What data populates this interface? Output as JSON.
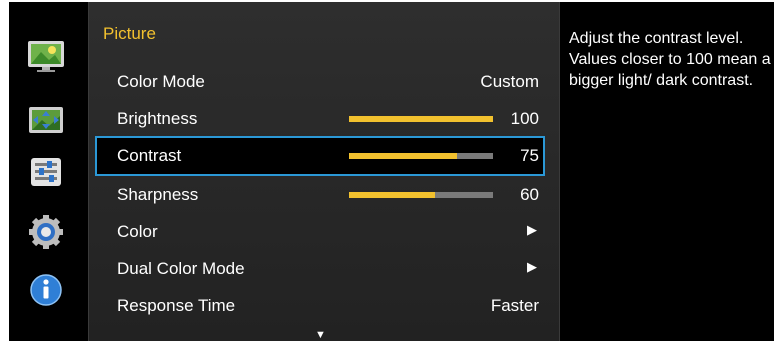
{
  "sidebar": {
    "icons": [
      "picture-icon",
      "onscreen-display-icon",
      "setup-reset-icon",
      "system-gear-icon",
      "information-icon"
    ]
  },
  "menu": {
    "title": "Picture",
    "items": [
      {
        "label": "Color Mode",
        "value": "Custom"
      },
      {
        "label": "Brightness",
        "value": "100",
        "level": 1.0
      },
      {
        "label": "Contrast",
        "value": "75",
        "level": 0.75
      },
      {
        "label": "Sharpness",
        "value": "60",
        "level": 0.6
      },
      {
        "label": "Color",
        "value": "▶"
      },
      {
        "label": "Dual Color Mode",
        "value": "▶"
      },
      {
        "label": "Response Time",
        "value": "Faster"
      }
    ],
    "selected_index": 2,
    "scroll_indicator": "▼"
  },
  "help": {
    "text": "Adjust the contrast level. Values closer to 100 mean a bigger light/ dark contrast."
  },
  "colors": {
    "accent": "#f2c12e",
    "selection_border": "#2b98d6",
    "bar_track": "#7a7a7a"
  }
}
